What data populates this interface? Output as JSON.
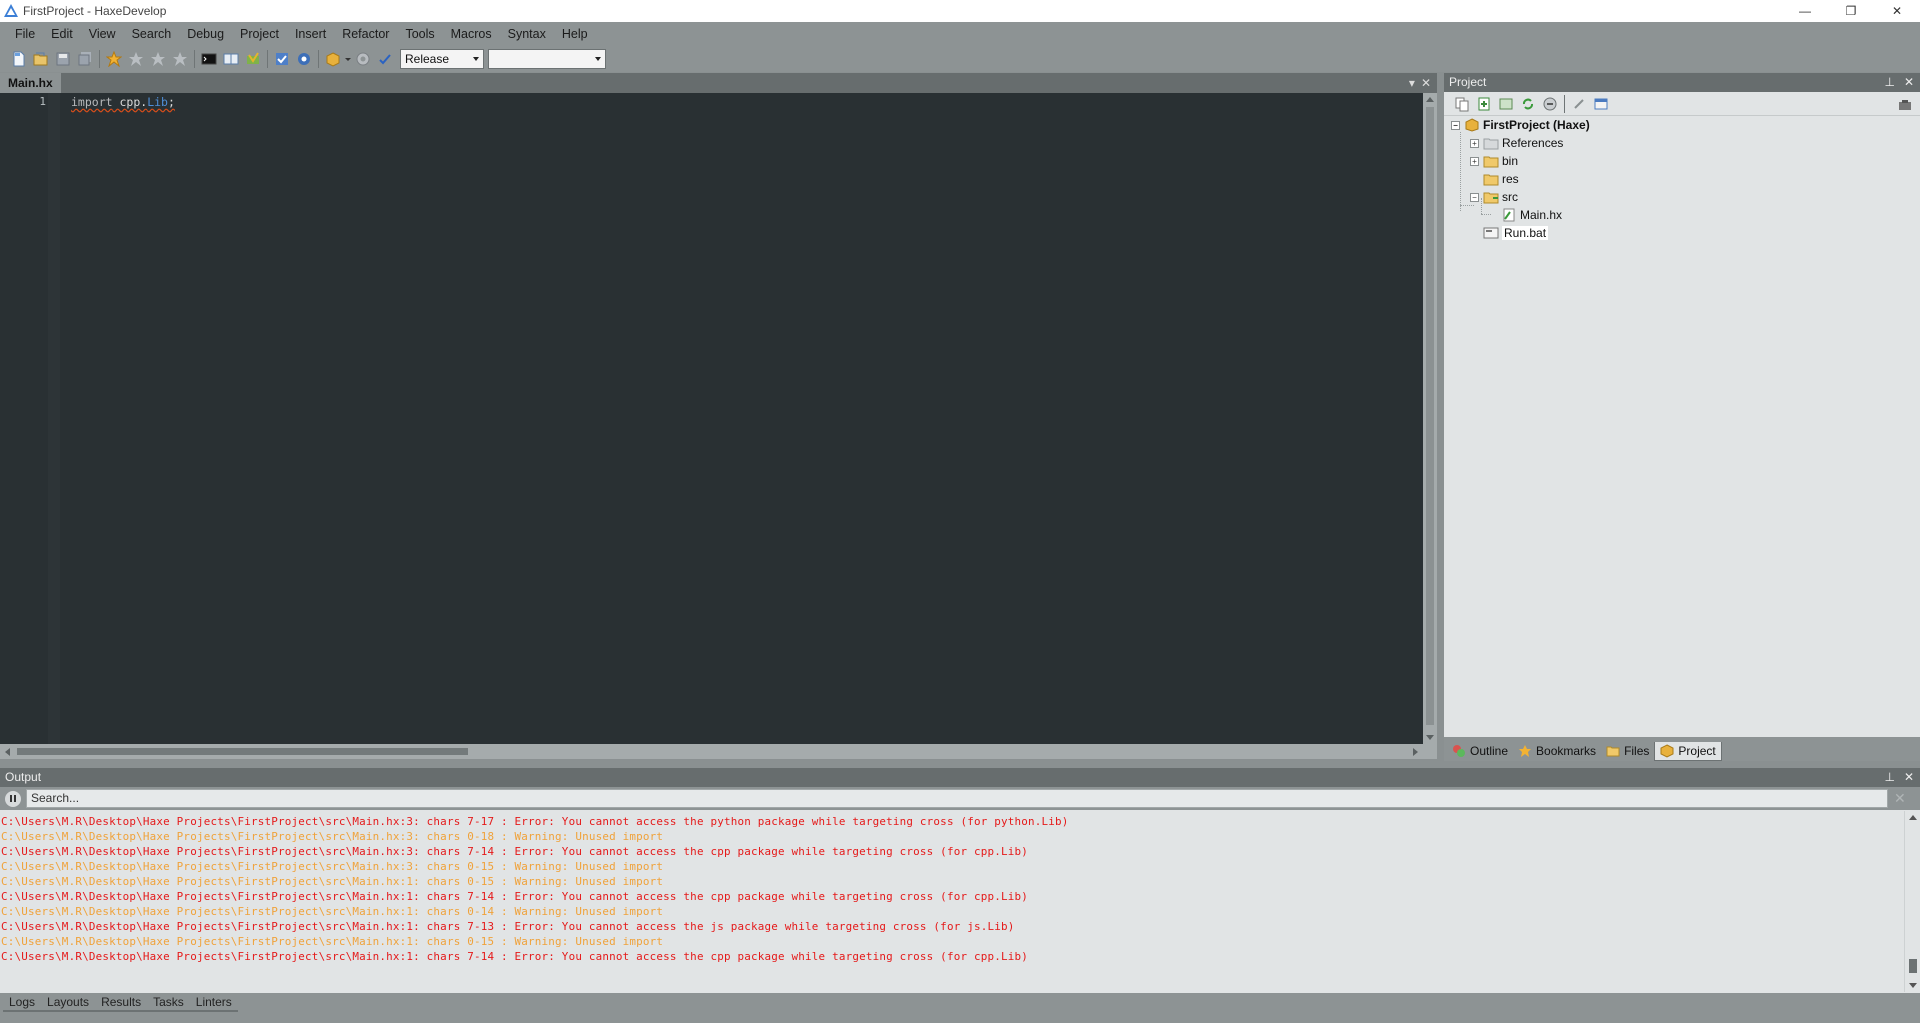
{
  "window": {
    "title": "FirstProject - HaxeDevelop",
    "controls": {
      "minimize": "—",
      "restore": "❐",
      "close": "✕"
    }
  },
  "menubar": {
    "items": [
      "File",
      "Edit",
      "View",
      "Search",
      "Debug",
      "Project",
      "Insert",
      "Refactor",
      "Tools",
      "Macros",
      "Syntax",
      "Help"
    ]
  },
  "toolbar": {
    "config_combo": {
      "value": "Release"
    },
    "target_combo": {
      "value": ""
    }
  },
  "editor": {
    "tab_label": "Main.hx",
    "tab_controls": {
      "dropdown": "▾",
      "close": "✕"
    },
    "line_numbers": [
      "1"
    ],
    "code": {
      "keyword": "import",
      "space": " ",
      "package": "cpp",
      "dot": ".",
      "class_name": "Lib",
      "semicolon": ";"
    }
  },
  "project_panel": {
    "title": "Project",
    "controls": {
      "pin": "⊥",
      "close": "✕"
    },
    "tree": {
      "root": "FirstProject (Haxe)",
      "items": [
        "References",
        "bin",
        "res",
        "src",
        "Main.hx",
        "Run.bat"
      ]
    },
    "bottom_tabs": [
      "Outline",
      "Bookmarks",
      "Files",
      "Project"
    ],
    "active_tab": "Project"
  },
  "output_panel": {
    "title": "Output",
    "controls": {
      "pin": "⊥",
      "close": "✕"
    },
    "search_placeholder": "Search...",
    "clear_glyph": "✕",
    "lines": [
      {
        "type": "error",
        "text": "C:\\Users\\M.R\\Desktop\\Haxe Projects\\FirstProject\\src\\Main.hx:3: chars 7-17 : Error: You cannot access the python package while targeting cross (for python.Lib)"
      },
      {
        "type": "warning",
        "text": "C:\\Users\\M.R\\Desktop\\Haxe Projects\\FirstProject\\src\\Main.hx:3: chars 0-18 : Warning: Unused import"
      },
      {
        "type": "error",
        "text": "C:\\Users\\M.R\\Desktop\\Haxe Projects\\FirstProject\\src\\Main.hx:3: chars 7-14 : Error: You cannot access the cpp package while targeting cross (for cpp.Lib)"
      },
      {
        "type": "warning",
        "text": "C:\\Users\\M.R\\Desktop\\Haxe Projects\\FirstProject\\src\\Main.hx:3: chars 0-15 : Warning: Unused import"
      },
      {
        "type": "warning",
        "text": "C:\\Users\\M.R\\Desktop\\Haxe Projects\\FirstProject\\src\\Main.hx:1: chars 0-15 : Warning: Unused import"
      },
      {
        "type": "error",
        "text": "C:\\Users\\M.R\\Desktop\\Haxe Projects\\FirstProject\\src\\Main.hx:1: chars 7-14 : Error: You cannot access the cpp package while targeting cross (for cpp.Lib)"
      },
      {
        "type": "warning",
        "text": "C:\\Users\\M.R\\Desktop\\Haxe Projects\\FirstProject\\src\\Main.hx:1: chars 0-14 : Warning: Unused import"
      },
      {
        "type": "error",
        "text": "C:\\Users\\M.R\\Desktop\\Haxe Projects\\FirstProject\\src\\Main.hx:1: chars 7-13 : Error: You cannot access the js package while targeting cross (for js.Lib)"
      },
      {
        "type": "warning",
        "text": "C:\\Users\\M.R\\Desktop\\Haxe Projects\\FirstProject\\src\\Main.hx:1: chars 0-15 : Warning: Unused import"
      },
      {
        "type": "error",
        "text": "C:\\Users\\M.R\\Desktop\\Haxe Projects\\FirstProject\\src\\Main.hx:1: chars 7-14 : Error: You cannot access the cpp package while targeting cross (for cpp.Lib)"
      }
    ],
    "tabs": [
      "Logs",
      "Layouts",
      "Results",
      "Tasks",
      "Linters"
    ]
  },
  "colors": {
    "editor_bg": "#293033",
    "chrome_gray": "#8d9394",
    "panel_header": "#676d6e",
    "error": "#e51a1a",
    "warning": "#f0a23a"
  }
}
